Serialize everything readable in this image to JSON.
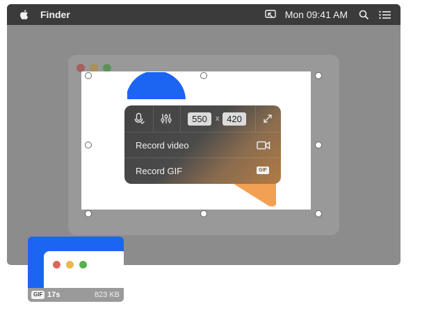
{
  "menubar": {
    "app_name": "Finder",
    "clock": "Mon 09:41 AM",
    "icons": [
      "apple-icon",
      "cast-icon",
      "search-icon",
      "list-icon"
    ]
  },
  "capture_panel": {
    "width_value": "550",
    "times_symbol": "x",
    "height_value": "420",
    "record_video_label": "Record video",
    "record_gif_label": "Record GIF",
    "gif_icon_text": "GIF"
  },
  "thumbnail": {
    "badge": "GIF",
    "duration": "17s",
    "size": "823 KB"
  },
  "colors": {
    "accent_blue": "#1c64f2",
    "accent_orange": "#f2a053",
    "traffic_red": "#e0645a",
    "traffic_yellow": "#e8b94a",
    "traffic_green": "#56b24b"
  }
}
